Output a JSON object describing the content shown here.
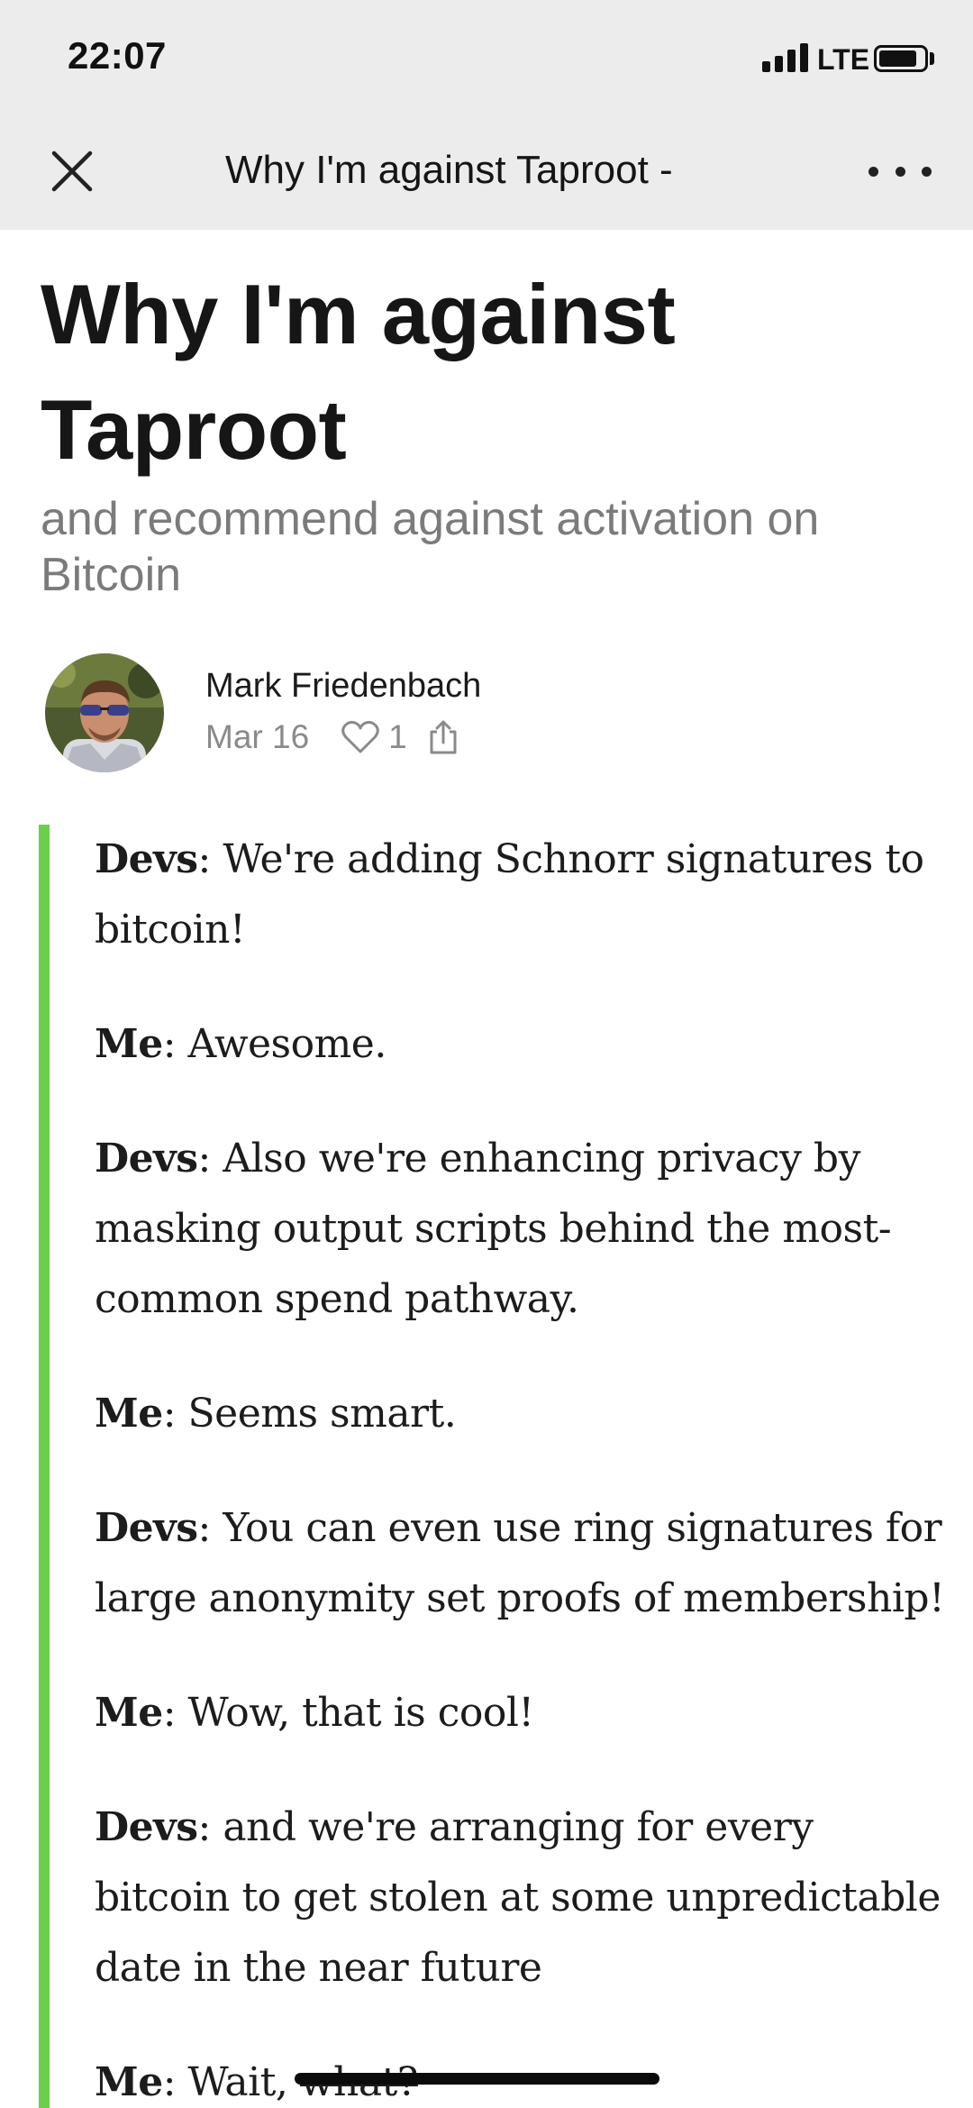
{
  "status_bar": {
    "time": "22:07",
    "network": "LTE",
    "signal_bars": 4,
    "battery_level": 0.85
  },
  "nav_bar": {
    "title": "Why I'm against Taproot -",
    "close_icon": "close-icon",
    "more_icon": "more-dots-icon"
  },
  "post": {
    "title": "Why I'm against Taproot",
    "subtitle": "and recommend against activation on Bitcoin",
    "author": {
      "name": "Mark Friedenbach"
    },
    "date": "Mar 16",
    "likes": "1",
    "like_icon": "heart-icon",
    "share_icon": "share-icon",
    "quote": [
      {
        "speaker": "Devs",
        "sep": ": ",
        "text": "We're adding Schnorr signatures to bitcoin!"
      },
      {
        "speaker": "Me",
        "sep": ": ",
        "text": "Awesome."
      },
      {
        "speaker": "Devs",
        "sep": ": ",
        "text": "Also we're enhancing privacy by masking output scripts behind the most-common spend pathway."
      },
      {
        "speaker": "Me",
        "sep": ": ",
        "text": "Seems smart."
      },
      {
        "speaker": "Devs",
        "sep": ": ",
        "text": "You can even use ring signatures for large anonymity set proofs of membership!"
      },
      {
        "speaker": "Me",
        "sep": ": ",
        "text": "Wow, that is cool!"
      },
      {
        "speaker": "Devs",
        "sep": ": ",
        "text": "and we're arranging for every bitcoin to get stolen at some unpredictable date in the near future"
      },
      {
        "speaker": "Me",
        "sep": ": ",
        "text": "Wait, ",
        "struck": "what?"
      }
    ]
  },
  "colors": {
    "quote_accent": "#6ad04c",
    "chrome_background": "#ececec",
    "subtitle_text": "#7b7b7b"
  }
}
